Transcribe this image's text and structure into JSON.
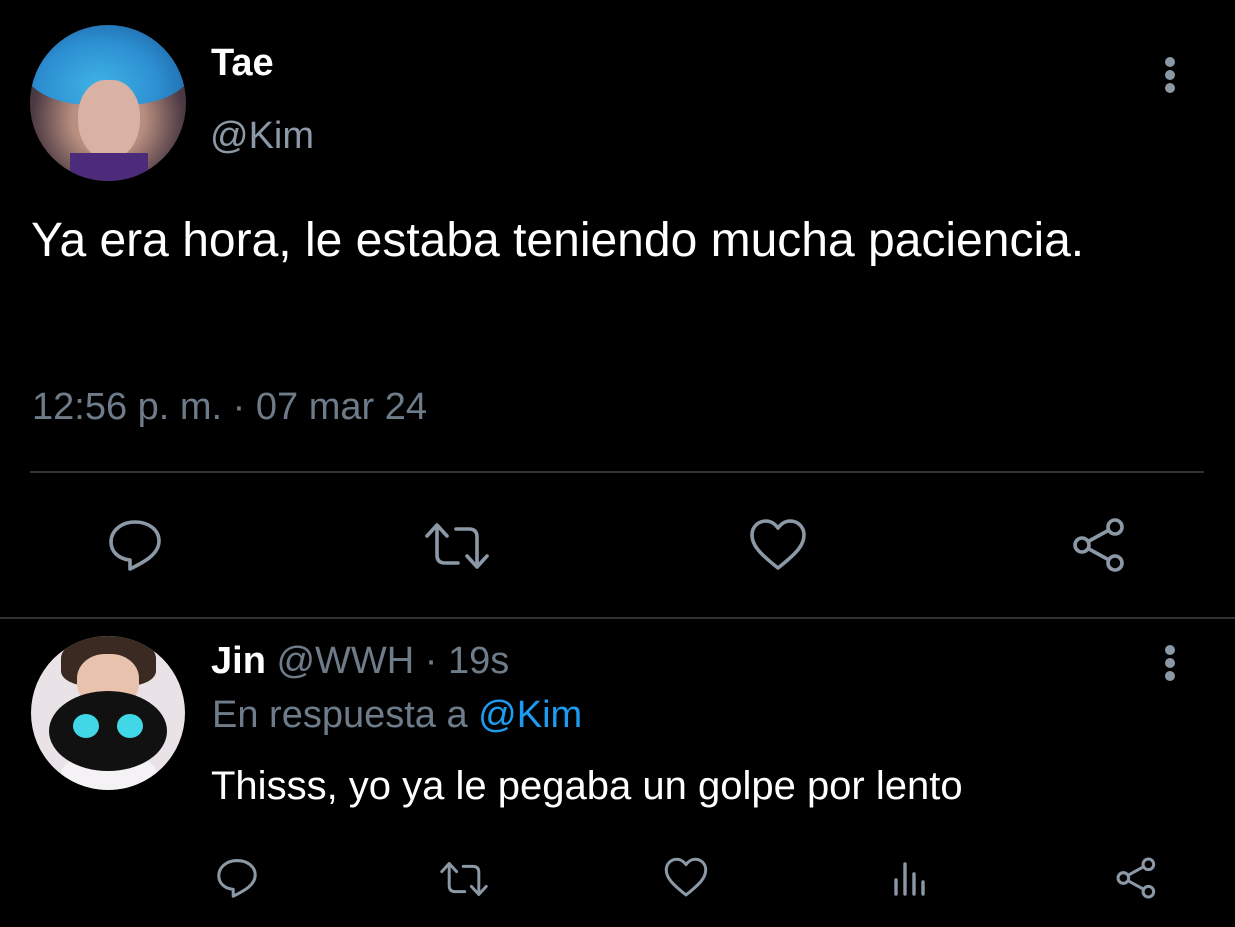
{
  "tweet": {
    "author_name": "Tae",
    "author_handle": "@Kim",
    "text": "Ya era hora, le estaba teniendo mucha paciencia.",
    "timestamp": "12:56 p. m. · 07 mar 24",
    "actions": [
      "reply-icon",
      "retweet-icon",
      "like-icon",
      "share-icon"
    ]
  },
  "reply": {
    "author_name": "Jin",
    "author_handle": "@WWH",
    "separator": "·",
    "age": "19s",
    "in_reply_prefix": "En respuesta a",
    "in_reply_to": "@Kim",
    "text": "Thisss, yo ya le pegaba un golpe por lento",
    "actions": [
      "reply-icon",
      "retweet-icon",
      "like-icon",
      "views-icon",
      "share-icon"
    ]
  },
  "colors": {
    "background": "#000000",
    "text_primary": "#ffffff",
    "text_secondary": "#6e7c8a",
    "accent": "#1d9bf0",
    "divider": "#2f3336"
  }
}
